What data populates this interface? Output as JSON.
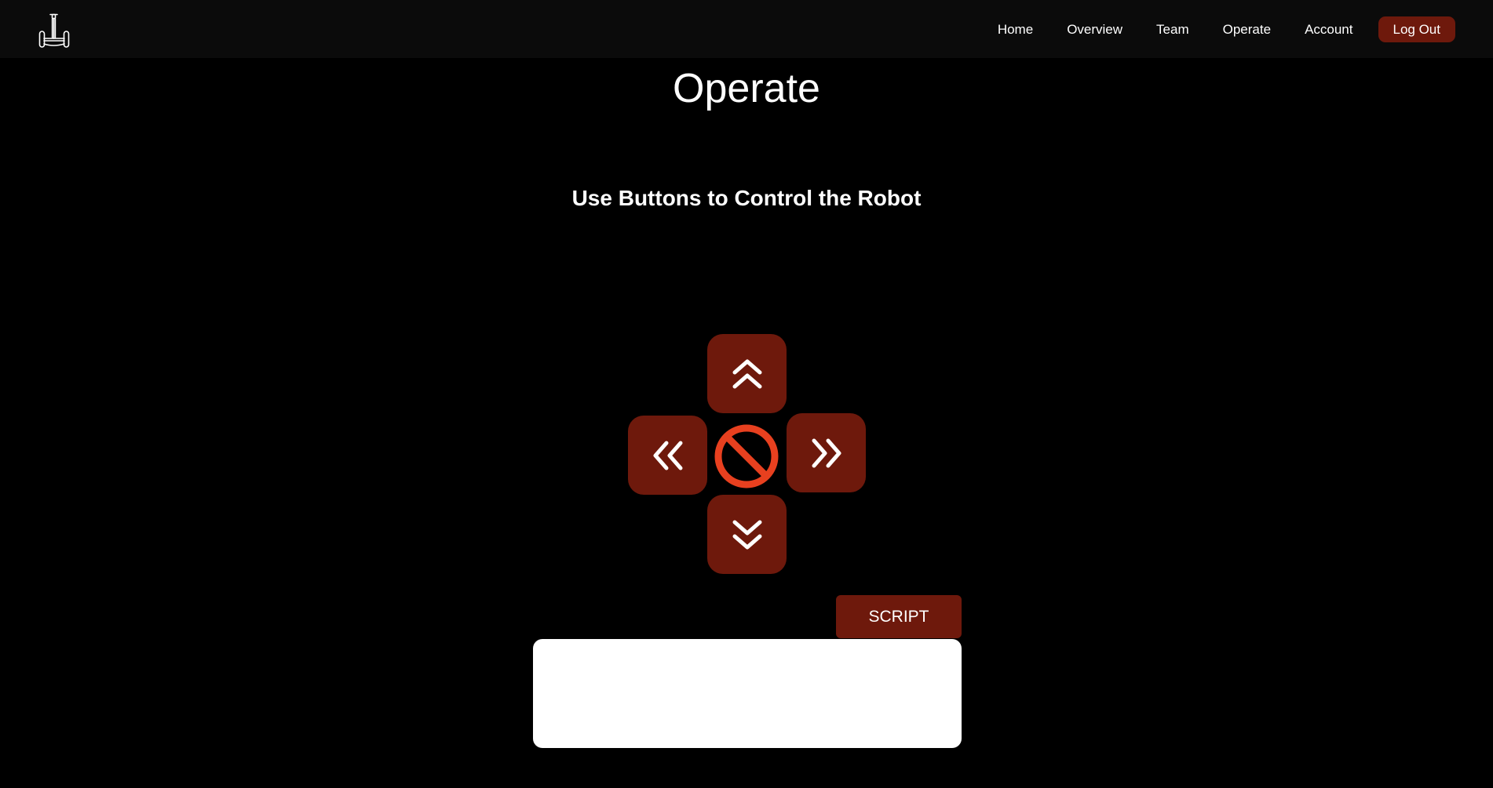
{
  "header": {
    "logo_icon": "segway-robot-icon",
    "nav": [
      {
        "label": "Home"
      },
      {
        "label": "Overview"
      },
      {
        "label": "Team"
      },
      {
        "label": "Operate"
      },
      {
        "label": "Account"
      }
    ],
    "logout_label": "Log Out"
  },
  "main": {
    "title": "Operate",
    "subtitle": "Use Buttons to Control the Robot",
    "controls": {
      "up_icon": "chevron-double-up-icon",
      "left_icon": "chevron-double-left-icon",
      "stop_icon": "stop-icon",
      "right_icon": "chevron-double-right-icon",
      "down_icon": "chevron-double-down-icon"
    },
    "script_label": "SCRIPT",
    "script_value": ""
  },
  "colors": {
    "background": "#000000",
    "navbar": "#0b0b0b",
    "button": "#6e190c",
    "stop": "#e8401f",
    "text": "#ffffff"
  }
}
